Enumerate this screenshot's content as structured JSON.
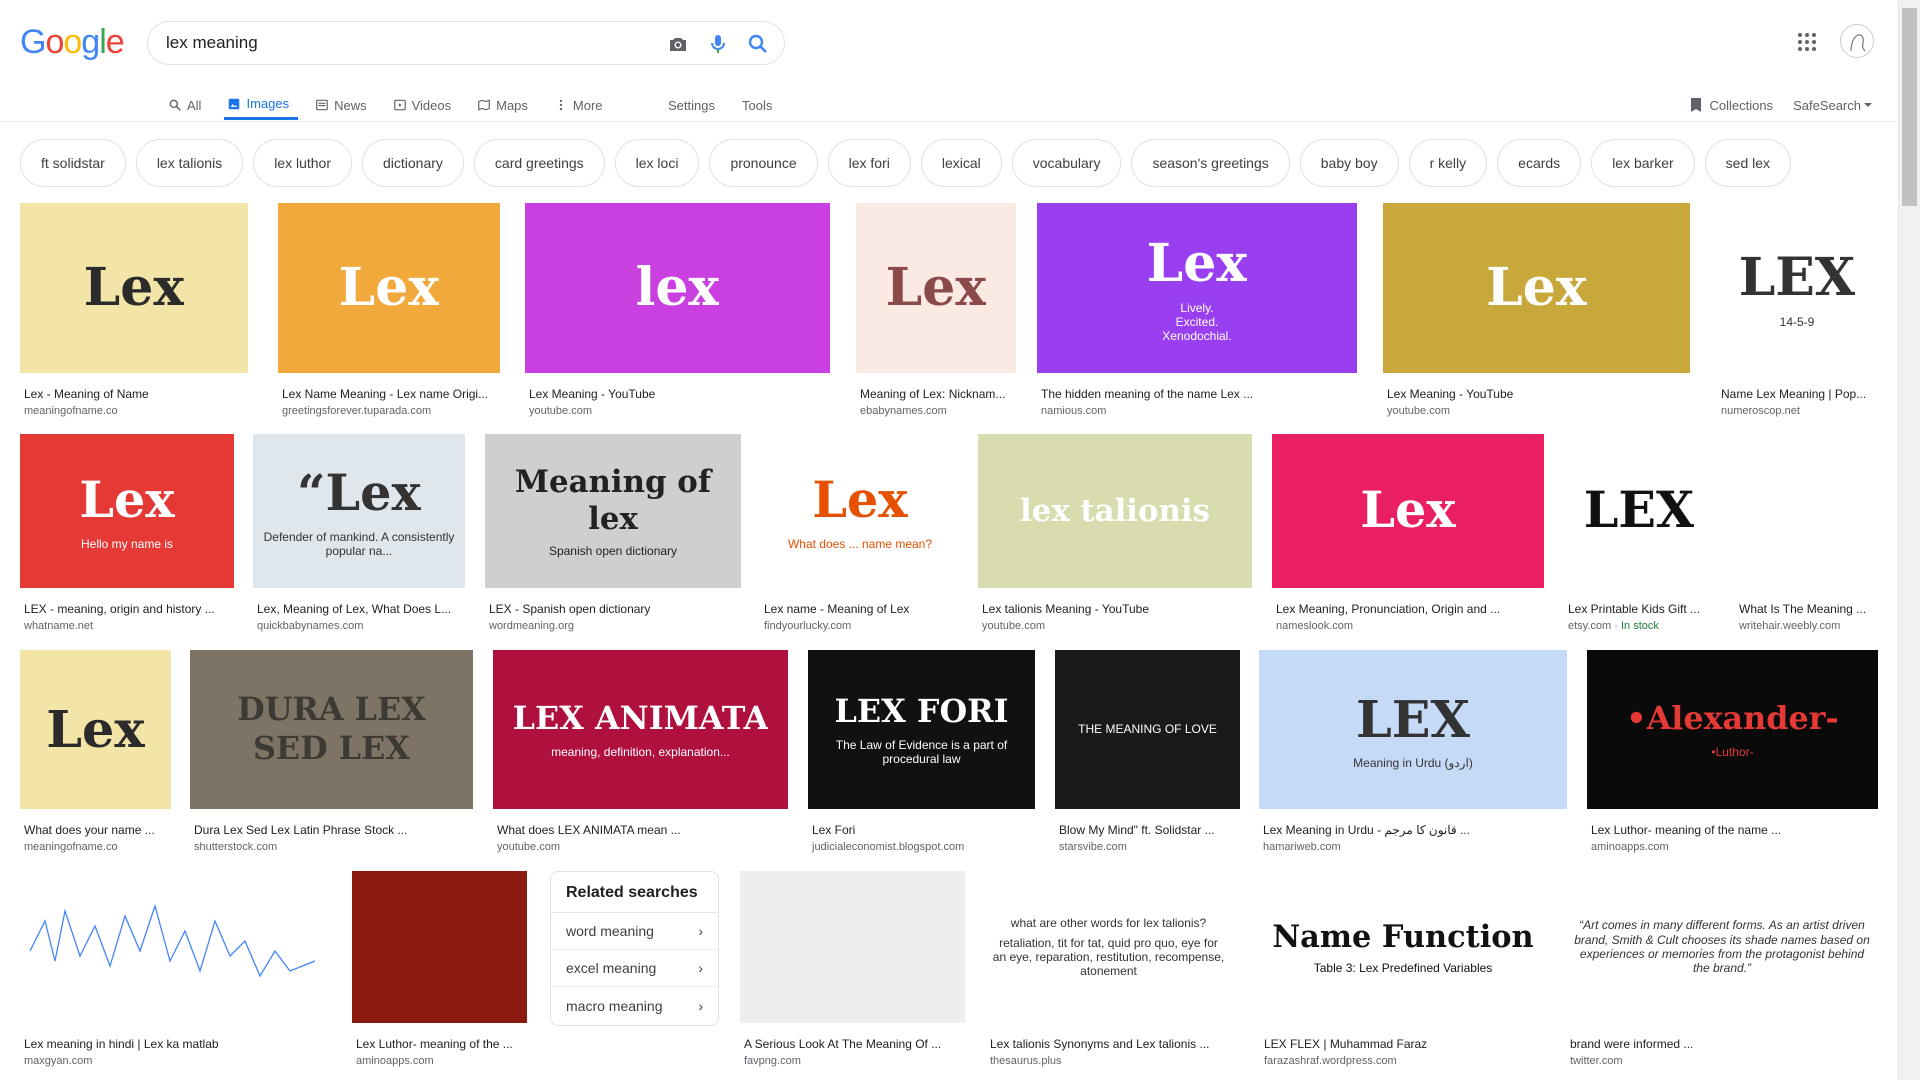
{
  "search": {
    "query": "lex meaning"
  },
  "nav": {
    "tabs": [
      {
        "label": "All",
        "icon": "search-icon"
      },
      {
        "label": "Images",
        "icon": "image-icon",
        "active": true
      },
      {
        "label": "News",
        "icon": "news-icon"
      },
      {
        "label": "Videos",
        "icon": "video-icon"
      },
      {
        "label": "Maps",
        "icon": "map-icon"
      },
      {
        "label": "More",
        "icon": "more-vert-icon"
      }
    ],
    "settings": "Settings",
    "tools": "Tools",
    "collections": "Collections",
    "safesearch": "SafeSearch"
  },
  "chips": [
    "ft solidstar",
    "lex talionis",
    "lex luthor",
    "dictionary",
    "card greetings",
    "lex loci",
    "pronounce",
    "lex fori",
    "lexical",
    "vocabulary",
    "season's greetings",
    "baby boy",
    "r kelly",
    "ecards",
    "lex barker",
    "sed lex"
  ],
  "results": [
    {
      "title": "Lex - Meaning of Name",
      "source": "meaningofname.co",
      "thumb_text": "Lex",
      "bg": "#f3e4a8",
      "fg": "#2b2b2b"
    },
    {
      "title": "Lex Name Meaning - Lex name Origi...",
      "source": "greetingsforever.tuparada.com",
      "thumb_text": "Lex",
      "bg": "#f0a93a",
      "fg": "#ffffff"
    },
    {
      "title": "Lex Meaning - YouTube",
      "source": "youtube.com",
      "thumb_text": "lex",
      "bg": "#c93fe0",
      "fg": "#ffffff"
    },
    {
      "title": "Meaning of Lex: Nicknam...",
      "source": "ebabynames.com",
      "thumb_text": "Lex",
      "bg": "#fbe9e4",
      "fg": "#8a4a4a"
    },
    {
      "title": "The hidden meaning of the name Lex ...",
      "source": "namious.com",
      "thumb_text": "Lex",
      "sub": "Lively.\nExcited.\nXenodochial.",
      "bg": "#9a3ff0",
      "fg": "#ffffff"
    },
    {
      "title": "Lex Meaning - YouTube",
      "source": "youtube.com",
      "thumb_text": "Lex",
      "bg": "#c9a83b",
      "fg": "#ffffff"
    },
    {
      "title": "Name Lex Meaning | Pop...",
      "source": "numeroscop.net",
      "thumb_text": "LEX",
      "sub": "14-5-9",
      "bg": "#ffffff",
      "fg": "#333333"
    },
    {
      "title": "LEX - meaning, origin and history ...",
      "source": "whatname.net",
      "thumb_text": "Lex",
      "sub": "Hello my name is",
      "bg": "#e53935",
      "fg": "#ffffff"
    },
    {
      "title": "Lex, Meaning of Lex, What Does L...",
      "source": "quickbabynames.com",
      "thumb_text": "“Lex",
      "sub": "Defender of mankind. A consistently popular na...",
      "bg": "#dfe6ec",
      "fg": "#333333"
    },
    {
      "title": "LEX - Spanish open dictionary",
      "source": "wordmeaning.org",
      "thumb_text": "Meaning of lex",
      "sub": "Spanish open dictionary",
      "bg": "#cfcfcf",
      "fg": "#222222"
    },
    {
      "title": "Lex name - Meaning of Lex",
      "source": "findyourlucky.com",
      "thumb_text": "Lex",
      "sub": "What does ... name mean?",
      "bg": "#ffffff",
      "fg": "#e65100"
    },
    {
      "title": "Lex talionis Meaning - YouTube",
      "source": "youtube.com",
      "thumb_text": "lex talionis",
      "bg": "#d9dcae",
      "fg": "#ffffff"
    },
    {
      "title": "Lex Meaning, Pronunciation, Origin and ...",
      "source": "nameslook.com",
      "thumb_text": "Lex",
      "bg": "#e91e63",
      "fg": "#ffffff"
    },
    {
      "title": "Lex Printable Kids Gift ...",
      "source": "etsy.com",
      "source_extra": "In stock",
      "thumb_text": "LEX",
      "bg": "#ffffff",
      "fg": "#111111"
    },
    {
      "title": "What Is The Meaning ...",
      "source": "writehair.weebly.com",
      "thumb_text": "",
      "bg": "#ffffff",
      "fg": "#666666"
    },
    {
      "title": "What does your name ...",
      "source": "meaningofname.co",
      "thumb_text": "Lex",
      "bg": "#f3e4a8",
      "fg": "#2b2b2b"
    },
    {
      "title": "Dura Lex Sed Lex Latin Phrase Stock ...",
      "source": "shutterstock.com",
      "thumb_text": "DURA LEX SED LEX",
      "bg": "#7e7466",
      "fg": "#3d3a34"
    },
    {
      "title": "What does LEX ANIMATA mean ...",
      "source": "youtube.com",
      "thumb_text": "LEX ANIMATA",
      "sub": "meaning, definition, explanation...",
      "bg": "#b0103e",
      "fg": "#ffffff"
    },
    {
      "title": "Lex Fori",
      "source": "judicialeconomist.blogspot.com",
      "thumb_text": "LEX FORI",
      "sub": "The Law of Evidence is a part of procedural law",
      "bg": "#111111",
      "fg": "#ffffff"
    },
    {
      "title": "Blow My Mind\" ft. Solidstar ...",
      "source": "starsvibe.com",
      "thumb_text": "THE MEANING OF LOVE",
      "bg": "#1a1a1a",
      "fg": "#ffffff"
    },
    {
      "title": "Lex Meaning in Urdu - قانون کا مرجم ...",
      "source": "hamariweb.com",
      "thumb_text": "LEX",
      "sub": "Meaning in Urdu (اردو)",
      "bg": "#c5daf7",
      "fg": "#333333"
    },
    {
      "title": "Lex Luthor- meaning of the name ...",
      "source": "aminoapps.com",
      "thumb_text": "•Alexander-",
      "sub": "•Luthor-",
      "bg": "#0a0a0a",
      "fg": "#e53935"
    },
    {
      "title": "Lex meaning in hindi | Lex ka matlab",
      "source": "maxgyan.com",
      "thumb_text": "",
      "bg": "#ffffff",
      "fg": "#1a73e8"
    },
    {
      "title": "Lex Luthor- meaning of the ...",
      "source": "aminoapps.com",
      "thumb_text": "",
      "bg": "#8b1a10",
      "fg": "#000000"
    },
    {
      "title": "A Serious Look At The Meaning Of ...",
      "source": "favpng.com",
      "thumb_text": "",
      "bg": "#eeeeee",
      "fg": "#555555"
    },
    {
      "title": "Lex talionis Synonyms and Lex talionis ...",
      "source": "thesaurus.plus",
      "thumb_text": "what are other words for lex talionis?",
      "sub": "retaliation, tit for tat, quid pro quo, eye for an eye, reparation, restitution, recompense, atonement",
      "bg": "#ffffff",
      "fg": "#333333"
    },
    {
      "title": "LEX FLEX | Muhammad Faraz",
      "source": "farazashraf.wordpress.com",
      "thumb_text": "Name   Function",
      "sub": "Table 3: Lex Predefined Variables",
      "bg": "#ffffff",
      "fg": "#111111"
    },
    {
      "title": "brand were informed ...",
      "source": "twitter.com",
      "thumb_text": "“Art comes in many different forms. As an artist driven brand, Smith & Cult chooses its shade names based on experiences or memories from the protagonist behind the brand.”",
      "bg": "#ffffff",
      "fg": "#333333"
    }
  ],
  "related": {
    "title": "Related searches",
    "items": [
      "word meaning",
      "excel meaning",
      "macro meaning"
    ]
  },
  "colors": {
    "accent": "#1a73e8",
    "chip_border": "#dfe1e5"
  }
}
